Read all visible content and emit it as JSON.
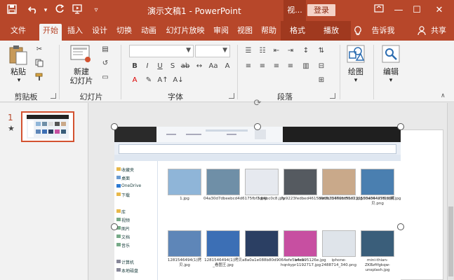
{
  "titlebar": {
    "window_title": "演示文稿1  -  PowerPoint",
    "context_tab": "视...",
    "login": "登录"
  },
  "tabs": [
    "文件",
    "开始",
    "插入",
    "设计",
    "切换",
    "动画",
    "幻灯片放映",
    "审阅",
    "视图",
    "帮助",
    "格式",
    "播放"
  ],
  "tell_me": "告诉我",
  "share": "共享",
  "ribbon": {
    "clipboard": {
      "label": "剪贴板",
      "paste": "粘贴"
    },
    "slides": {
      "label": "幻灯片",
      "new_slide_line1": "新建",
      "new_slide_line2": "幻灯片"
    },
    "font": {
      "label": "字体"
    },
    "paragraph": {
      "label": "段落"
    },
    "drawing": {
      "label": "绘图"
    },
    "editing": {
      "label": "编辑"
    }
  },
  "thumbnail": {
    "number": "1",
    "star": "★"
  },
  "picture": {
    "nav": [
      "收藏夹",
      "桌面",
      "OneDrive",
      "下载",
      "库",
      "视频",
      "图片",
      "文档",
      "音乐",
      "计算机",
      "本地磁盘"
    ],
    "files": [
      {
        "name": "1.jpg",
        "color": "#8fb5d8"
      },
      {
        "name": "04a30d7dbeebcd4d6175fbf3df4bc0c8.jpg",
        "color": "#6f8fa7"
      },
      {
        "name": "7.jpg",
        "color": "#e6e9ef"
      },
      {
        "name": "7e9223fedbed4615b9f2c32362cfff8e1.jpg",
        "color": "#555a60"
      },
      {
        "name": "9ed6254766c513231550e344a5f0d0b.jpg",
        "color": "#c9a98a"
      },
      {
        "name": "1034064778(1)拷贝.png",
        "color": "#4a7fb0"
      },
      {
        "name": "1281546494(1)拷贝.jpg",
        "color": "#5e86b8"
      },
      {
        "name": "1281546494(1)拷贝_看图王.jpg",
        "color": "#3c6fb5"
      },
      {
        "name": "a8a0a1e088b80d9064efe5b4ea95126e.jpg",
        "color": "#2b3f63"
      },
      {
        "name": "efe9-hqnkypr1192717.jpg",
        "color": "#c74fa1"
      },
      {
        "name": "iphone-2488714_340.png",
        "color": "#dfe4ea"
      },
      {
        "name": "mini-thian-ZKBzfifgkqw-unsplash.jpg",
        "color": "#3a5e7a"
      }
    ]
  },
  "colors": {
    "accent": "#b7472a",
    "ribbon_bg": "#f3f3f3"
  }
}
